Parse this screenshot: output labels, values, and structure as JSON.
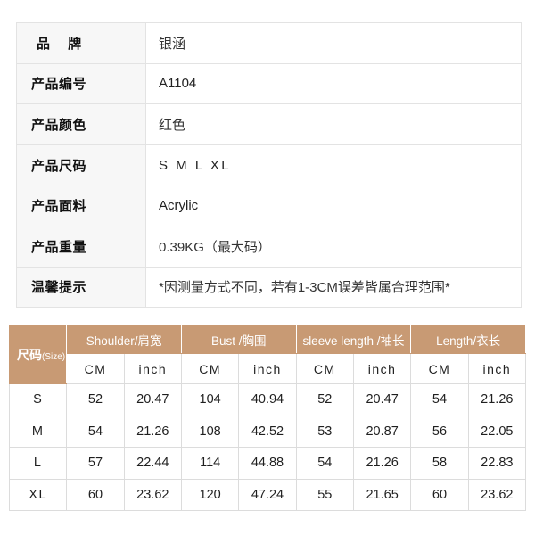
{
  "product_info": {
    "rows": [
      {
        "label": "品 牌",
        "value": "银涵",
        "spaced": true,
        "cjk": true
      },
      {
        "label": "产品编号",
        "value": "A1104",
        "spaced": false,
        "cjk": false
      },
      {
        "label": "产品颜色",
        "value": "红色",
        "spaced": false,
        "cjk": true
      },
      {
        "label": "产品尺码",
        "value": "S M L XL",
        "spaced": false,
        "cjk": false
      },
      {
        "label": "产品面料",
        "value": "Acrylic",
        "spaced": false,
        "cjk": false
      },
      {
        "label": "产品重量",
        "value": "0.39KG（最大码）",
        "spaced": false,
        "cjk": true
      },
      {
        "label": "温馨提示",
        "value": "*因测量方式不同，若有1-3CM误差皆属合理范围*",
        "spaced": false,
        "cjk": true
      }
    ]
  },
  "size_chart": {
    "corner_label": "尺码",
    "corner_sub": "(Size)",
    "groups": [
      {
        "label": "Shoulder/肩宽"
      },
      {
        "label": "Bust /胸围"
      },
      {
        "label": "sleeve length /袖长"
      },
      {
        "label": "Length/衣长"
      }
    ],
    "units": [
      "CM",
      "inch",
      "CM",
      "inch",
      "CM",
      "inch",
      "CM",
      "inch"
    ],
    "rows": [
      {
        "size": "S",
        "values": [
          "52",
          "20.47",
          "104",
          "40.94",
          "52",
          "20.47",
          "54",
          "21.26"
        ]
      },
      {
        "size": "M",
        "values": [
          "54",
          "21.26",
          "108",
          "42.52",
          "53",
          "20.87",
          "56",
          "22.05"
        ]
      },
      {
        "size": "L",
        "values": [
          "57",
          "22.44",
          "114",
          "44.88",
          "54",
          "21.26",
          "58",
          "22.83"
        ]
      },
      {
        "size": "XL",
        "values": [
          "60",
          "23.62",
          "120",
          "47.24",
          "55",
          "21.65",
          "60",
          "23.62"
        ]
      }
    ]
  },
  "colors": {
    "header_tan": "#c89a74",
    "label_bg": "#f7f7f7",
    "border": "#e3e3e3"
  }
}
